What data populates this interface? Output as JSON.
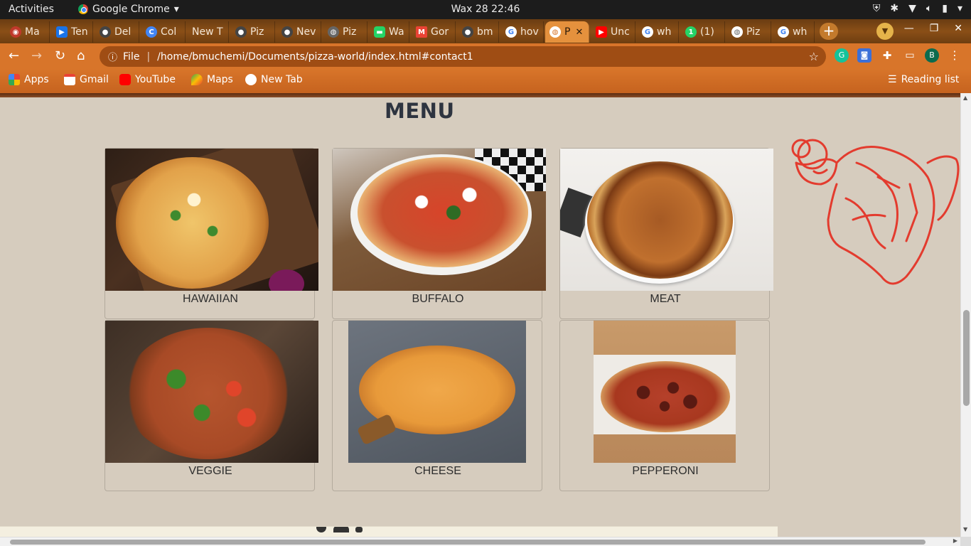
{
  "os": {
    "activities": "Activities",
    "app_name": "Google Chrome",
    "clock": "Wax 28  22:46"
  },
  "tabs": [
    {
      "label": "Ma",
      "color": "#c0392b"
    },
    {
      "label": "Ten",
      "color": "#1a73e8"
    },
    {
      "label": "Del",
      "color": "#444444"
    },
    {
      "label": "Col",
      "color": "#4285f4"
    },
    {
      "label": "New T",
      "color": ""
    },
    {
      "label": "Piz",
      "color": "#444444"
    },
    {
      "label": "Nev",
      "color": "#444444"
    },
    {
      "label": "Piz",
      "color": "#666666"
    },
    {
      "label": "Wa",
      "color": "#25d366"
    },
    {
      "label": "Gor",
      "color": "#ea4335"
    },
    {
      "label": "bm",
      "color": "#444444"
    },
    {
      "label": "hov",
      "color": "#4285f4"
    },
    {
      "label": "P",
      "color": "#ffffff",
      "active": true
    },
    {
      "label": "Unc",
      "color": "#ff0000"
    },
    {
      "label": "wh",
      "color": "#4285f4"
    },
    {
      "label": "(1)",
      "color": "#25d366"
    },
    {
      "label": "Piz",
      "color": "#666666"
    },
    {
      "label": "wh",
      "color": "#4285f4"
    }
  ],
  "toolbar": {
    "url_scheme_label": "File",
    "url": "/home/bmuchemi/Documents/pizza-world/index.html#contact1",
    "profile_initial": "B"
  },
  "bookmarks": {
    "items": [
      "Apps",
      "Gmail",
      "YouTube",
      "Maps",
      "New Tab"
    ],
    "reading_list": "Reading list"
  },
  "page": {
    "menu_title": "MENU",
    "items": [
      {
        "name": "HAWAIIAN"
      },
      {
        "name": "BUFFALO"
      },
      {
        "name": "MEAT"
      },
      {
        "name": "VEGGIE"
      },
      {
        "name": "CHEESE"
      },
      {
        "name": "PEPPERONI"
      }
    ]
  },
  "colors": {
    "tab_strip": "#7a4514",
    "toolbar": "#d8752a",
    "page_bg": "#d6ccbe",
    "chef_line": "#e33b2e",
    "title_text": "#2e3440"
  }
}
